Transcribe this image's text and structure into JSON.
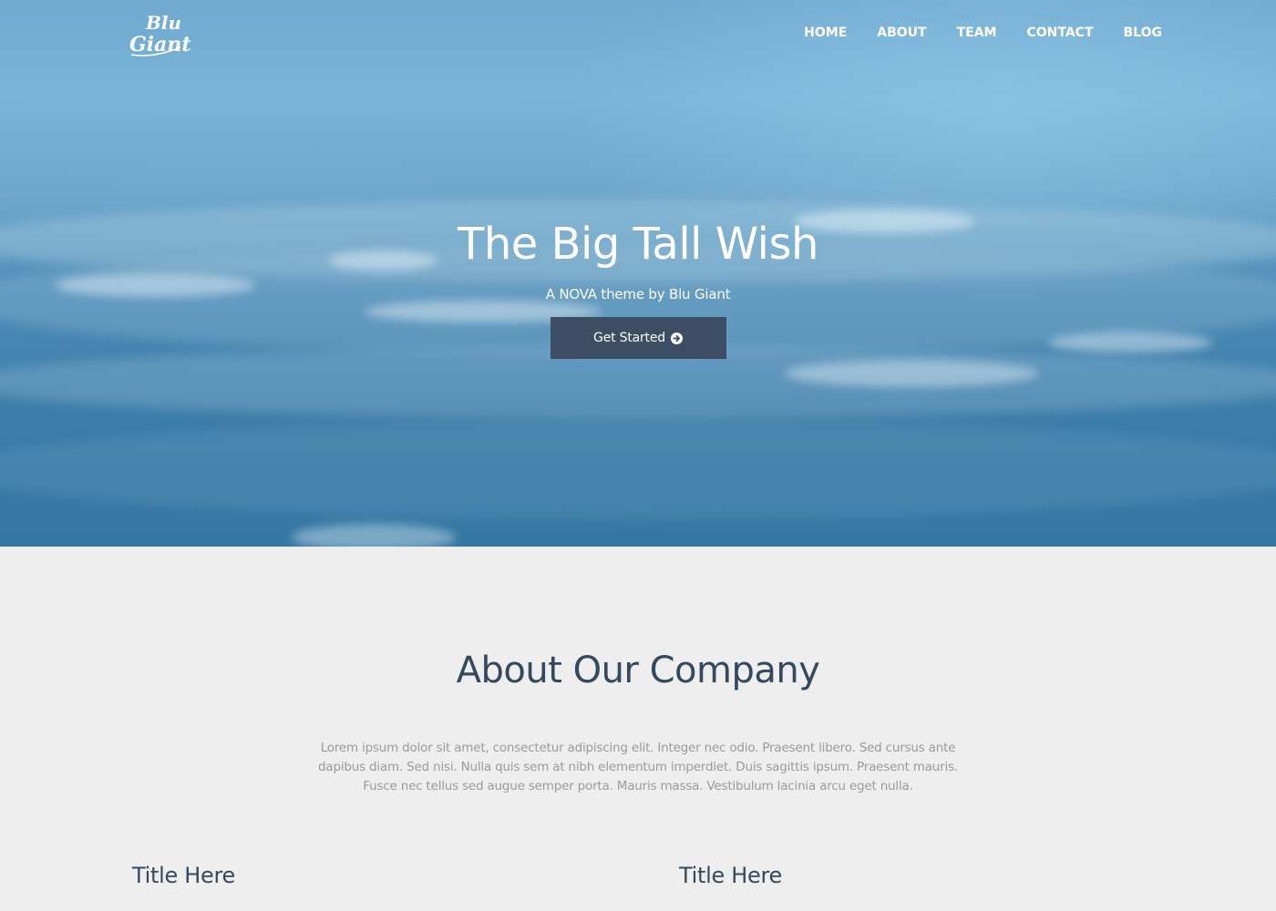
{
  "brand": {
    "logo_line1": "Blu",
    "logo_line2": "Giant"
  },
  "nav": {
    "items": [
      {
        "label": "HOME"
      },
      {
        "label": "ABOUT"
      },
      {
        "label": "TEAM"
      },
      {
        "label": "CONTACT"
      },
      {
        "label": "BLOG"
      }
    ]
  },
  "hero": {
    "title": "The Big Tall Wish",
    "subtitle": "A NOVA theme by Blu Giant",
    "button_label": "Get Started",
    "button_icon": "arrow-right-icon"
  },
  "about": {
    "title": "About Our Company",
    "text": "Lorem ipsum dolor sit amet, consectetur adipiscing elit. Integer nec odio. Praesent libero. Sed cursus ante dapibus diam. Sed nisi. Nulla quis sem at nibh elementum imperdiet. Duis sagittis ipsum. Praesent mauris. Fusce nec tellus sed augue semper porta. Mauris massa. Vestibulum lacinia arcu eget nulla.",
    "columns": [
      {
        "title": "Title Here"
      },
      {
        "title": "Title Here"
      }
    ]
  },
  "colors": {
    "button_bg": "#3d4d63",
    "heading": "#34495e",
    "body_text": "#9a9a9a",
    "section_bg": "#eeeeee"
  }
}
